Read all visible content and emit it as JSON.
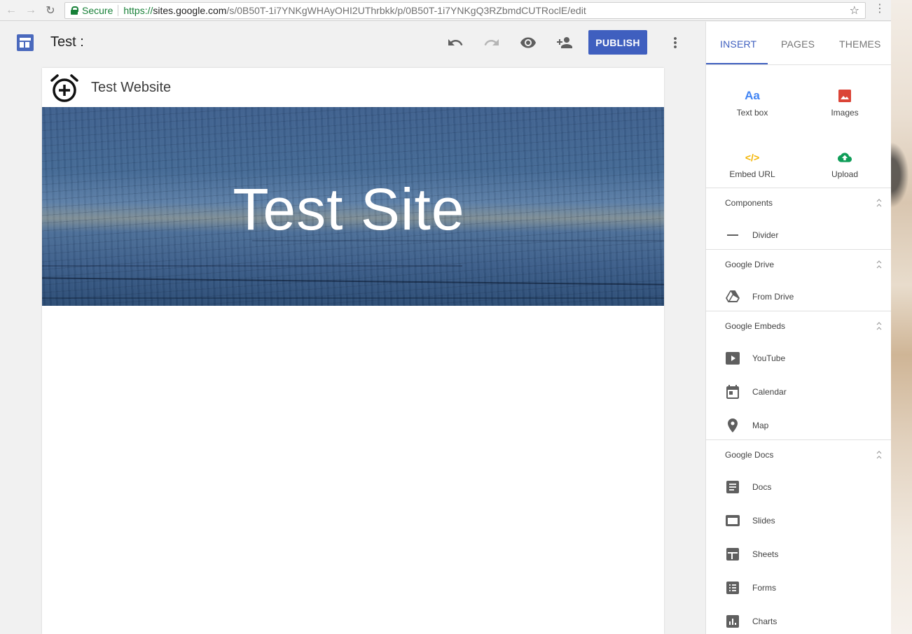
{
  "browser": {
    "secure_label": "Secure",
    "url_protocol": "https://",
    "url_host": "sites.google.com",
    "url_path": "/s/0B50T-1i7YNKgWHAyOHI2UThrbkk/p/0B50T-1i7YNKgQ3RZbmdCUTRoclE/edit"
  },
  "toolbar": {
    "title": "Test :",
    "publish_label": "PUBLISH"
  },
  "site": {
    "name": "Test Website",
    "banner_title": "Test Site"
  },
  "panel": {
    "tabs": [
      {
        "label": "INSERT",
        "active": true
      },
      {
        "label": "PAGES",
        "active": false
      },
      {
        "label": "THEMES",
        "active": false
      }
    ],
    "insert_tiles": [
      {
        "label": "Text box",
        "icon": "text-box-icon",
        "icon_text": "Aa"
      },
      {
        "label": "Images",
        "icon": "image-icon"
      },
      {
        "label": "Embed URL",
        "icon": "embed-code-icon",
        "icon_text": "</>"
      },
      {
        "label": "Upload",
        "icon": "cloud-upload-icon"
      }
    ],
    "sections": [
      {
        "title": "Components",
        "items": [
          {
            "label": "Divider",
            "icon": "divider-icon"
          }
        ]
      },
      {
        "title": "Google Drive",
        "items": [
          {
            "label": "From Drive",
            "icon": "drive-icon"
          }
        ]
      },
      {
        "title": "Google Embeds",
        "items": [
          {
            "label": "YouTube",
            "icon": "youtube-icon"
          },
          {
            "label": "Calendar",
            "icon": "calendar-icon"
          },
          {
            "label": "Map",
            "icon": "map-pin-icon"
          }
        ]
      },
      {
        "title": "Google Docs",
        "items": [
          {
            "label": "Docs",
            "icon": "docs-icon"
          },
          {
            "label": "Slides",
            "icon": "slides-icon"
          },
          {
            "label": "Sheets",
            "icon": "sheets-icon"
          },
          {
            "label": "Forms",
            "icon": "forms-icon"
          },
          {
            "label": "Charts",
            "icon": "charts-icon"
          }
        ]
      }
    ]
  },
  "colors": {
    "accent": "#3f5fbf",
    "text_box_icon": "#4285f4",
    "image_icon": "#db4437",
    "embed_icon": "#f4b400",
    "upload_icon": "#0f9d58"
  }
}
